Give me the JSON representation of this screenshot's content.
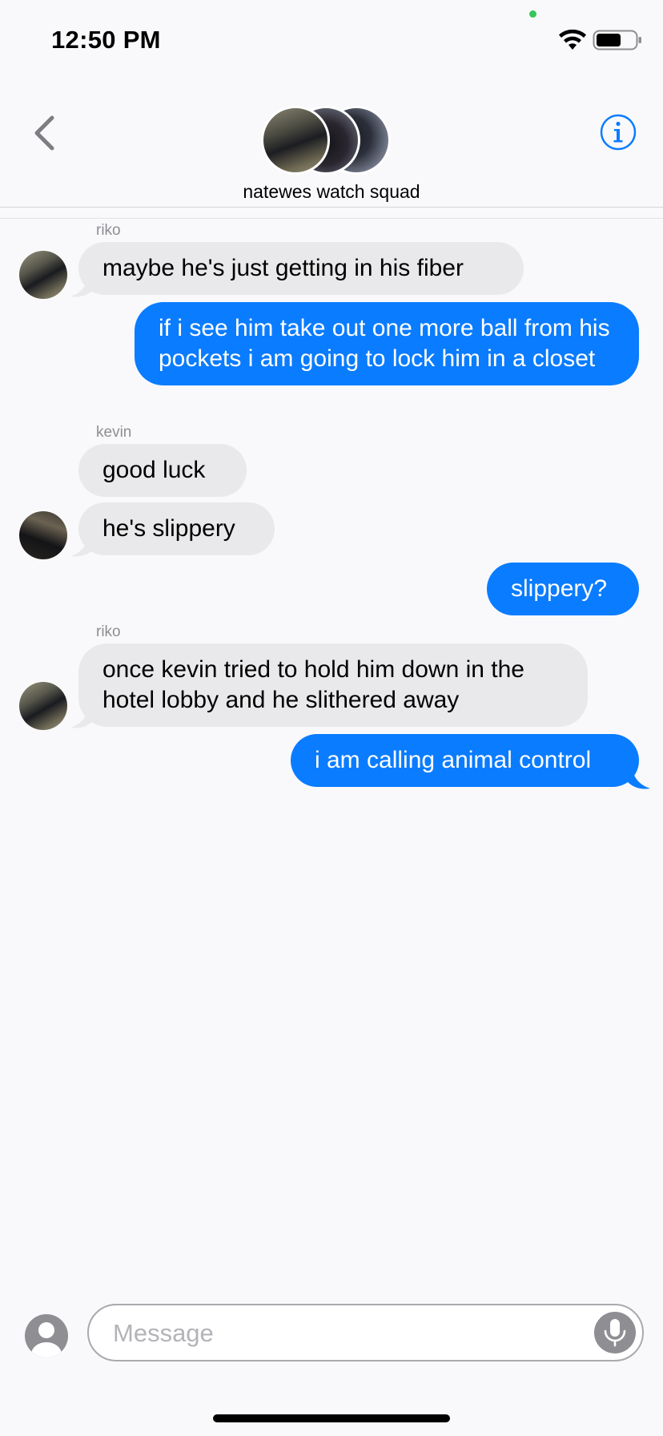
{
  "status_bar": {
    "time": "12:50 PM",
    "privacy_dot_color": "#34c759",
    "icons": [
      "wifi-icon",
      "battery-icon"
    ]
  },
  "header": {
    "group_name": "natewes watch squad",
    "back_icon": "chevron-left-icon",
    "info_icon": "info-icon",
    "accent_color": "#0a7cff"
  },
  "messages": [
    {
      "sender": "riko",
      "direction": "incoming",
      "text": "maybe he's just getting in his fiber"
    },
    {
      "direction": "outgoing",
      "text": "if i see him take out one more ball from his pockets i am going to lock him in a closet"
    },
    {
      "sender": "kevin",
      "direction": "incoming",
      "text": "good luck"
    },
    {
      "direction": "incoming",
      "text": "he's slippery"
    },
    {
      "direction": "outgoing",
      "text": "slippery?"
    },
    {
      "sender": "riko",
      "direction": "incoming",
      "text": "once kevin tried to hold him down in the hotel lobby and he slithered away"
    },
    {
      "direction": "outgoing",
      "text": "i am calling animal control"
    }
  ],
  "composer": {
    "placeholder": "Message",
    "value": "",
    "contact_icon": "person-icon",
    "mic_icon": "microphone-icon"
  },
  "colors": {
    "incoming_bubble": "#e9e9eb",
    "outgoing_bubble": "#0a7cff",
    "background": "#f9f9fb"
  }
}
